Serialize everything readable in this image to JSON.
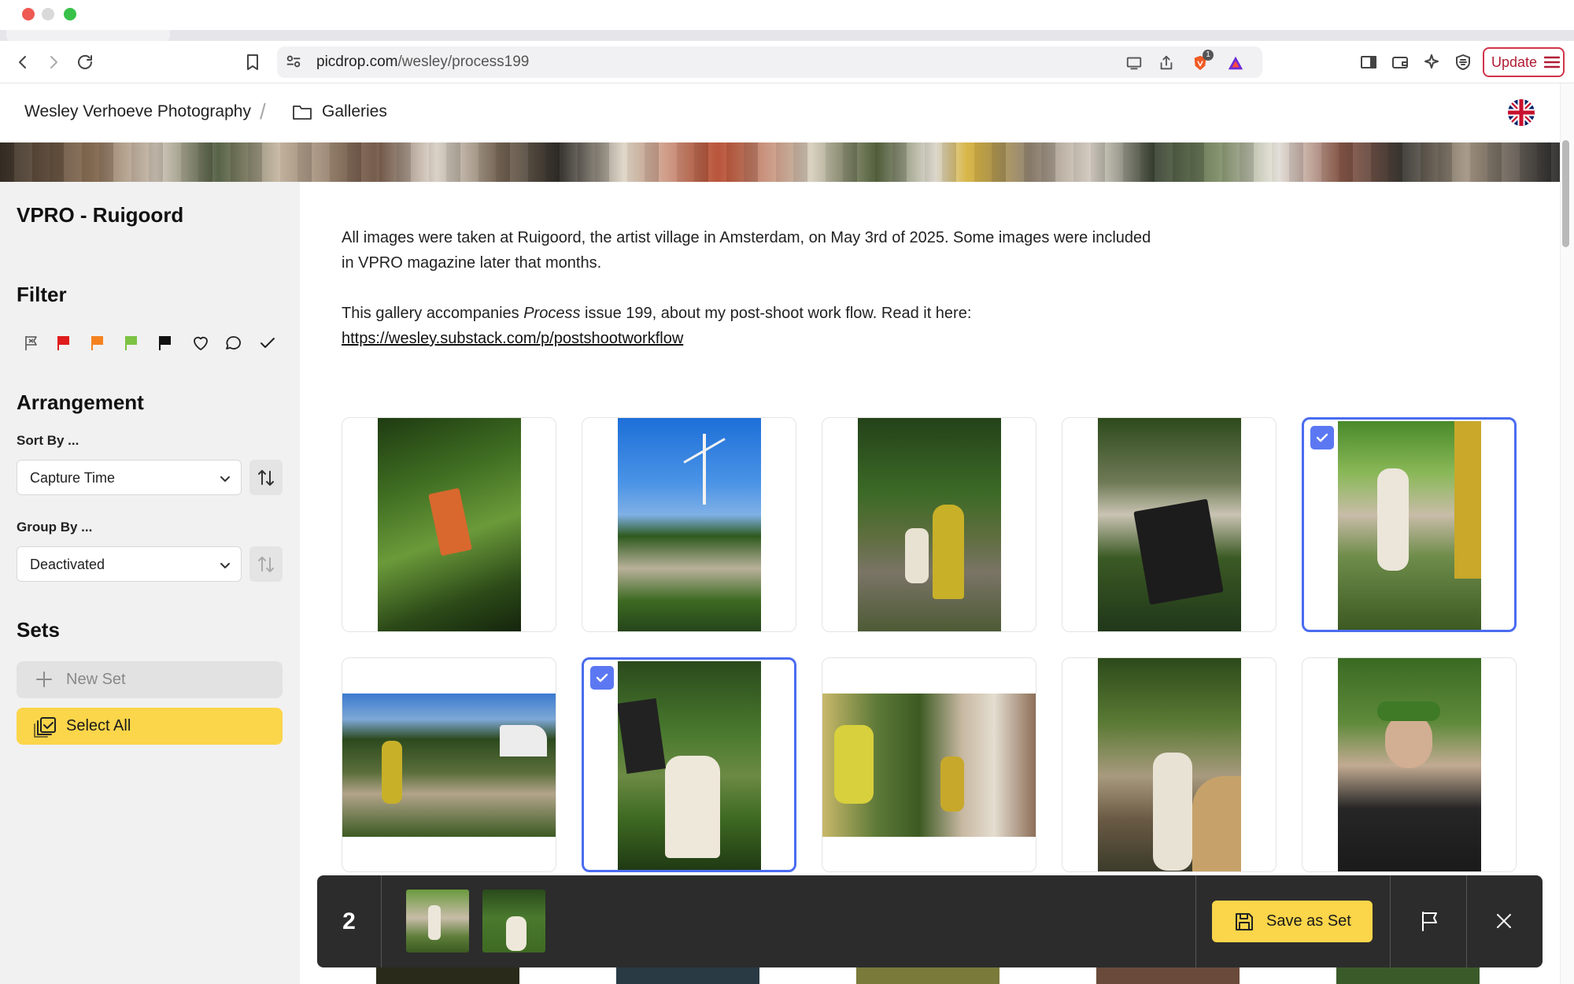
{
  "browser": {
    "url_host": "picdrop.com",
    "url_path": "/wesley/process199",
    "brave_shield_count": "1",
    "update_label": "Update"
  },
  "header": {
    "home_crumb": "Wesley Verhoeve Photography",
    "separator": "/",
    "galleries_crumb": "Galleries"
  },
  "sidebar": {
    "gallery_title": "VPRO - Ruigoord",
    "filter_heading": "Filter",
    "filter_icons": [
      "flag-outline-icon",
      "red-flag-icon",
      "orange-flag-icon",
      "green-flag-icon",
      "black-flag-icon",
      "heart-icon",
      "comment-icon",
      "check-icon"
    ],
    "arrangement_heading": "Arrangement",
    "sort_by_label": "Sort By ...",
    "sort_by_value": "Capture Time",
    "group_by_label": "Group By ...",
    "group_by_value": "Deactivated",
    "sets_heading": "Sets",
    "new_set_label": "New Set",
    "select_all_label": "Select All"
  },
  "main": {
    "desc_line1": "All images were taken at Ruigoord, the artist village in Amsterdam, on May 3rd of 2025. Some images were included in VPRO magazine later that months.",
    "desc_p2_before": "This gallery accompanies ",
    "desc_p2_em": "Process",
    "desc_p2_after": " issue 199, about my post-shoot work flow. Read it here:",
    "desc_link": "https://wesley.substack.com/p/postshootworkflow"
  },
  "selection": {
    "count": "2",
    "save_label": "Save as Set"
  },
  "colors": {
    "accent_yellow": "#fbd54a",
    "selection_blue": "#4a6cf0",
    "flag_red": "#e01c1c",
    "flag_orange": "#f5821f",
    "flag_green": "#7cc243",
    "flag_black": "#111111"
  }
}
